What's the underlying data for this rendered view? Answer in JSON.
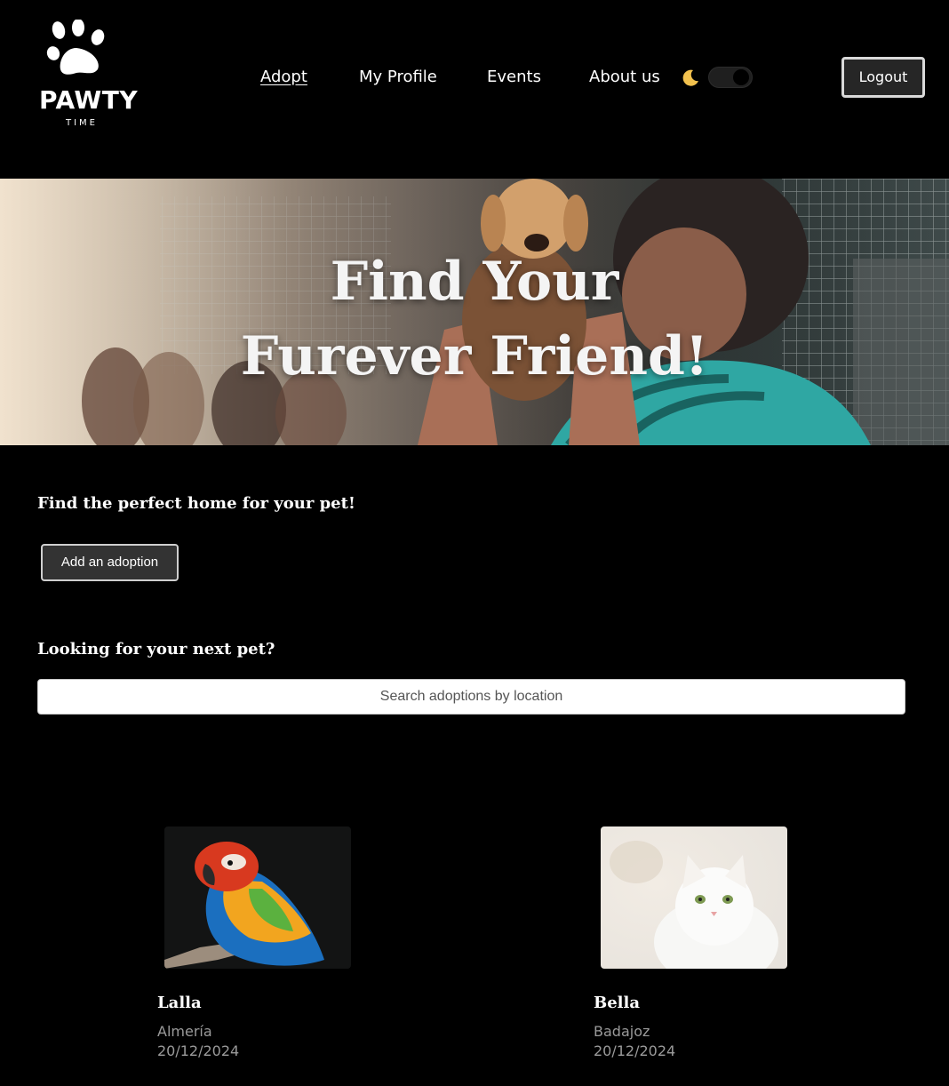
{
  "brand": {
    "name": "PAWTY",
    "tagline": "TIME"
  },
  "nav": {
    "items": [
      {
        "label": "Adopt",
        "active": true
      },
      {
        "label": "My Profile",
        "active": false
      },
      {
        "label": "Events",
        "active": false
      },
      {
        "label": "About us",
        "active": false
      }
    ],
    "theme_icon": "moon-icon",
    "dark_mode_toggle": "on",
    "logout_label": "Logout"
  },
  "hero": {
    "line1": "Find Your",
    "line2": "Furever Friend!"
  },
  "section": {
    "heading": "Find the perfect home for your pet!",
    "add_label": "Add an adoption",
    "search_heading": "Looking for your next pet?",
    "search_placeholder": "Search adoptions by location",
    "search_value": ""
  },
  "adoptions": [
    {
      "name": "Lalla",
      "location": "Almería",
      "date": "20/12/2024",
      "photo": "parrot-photo"
    },
    {
      "name": "Bella",
      "location": "Badajoz",
      "date": "20/12/2024",
      "photo": "white-cat-photo"
    }
  ],
  "colors": {
    "background": "#000000",
    "text": "#ffffff",
    "muted": "#9a9a9a",
    "button": "#333333"
  }
}
